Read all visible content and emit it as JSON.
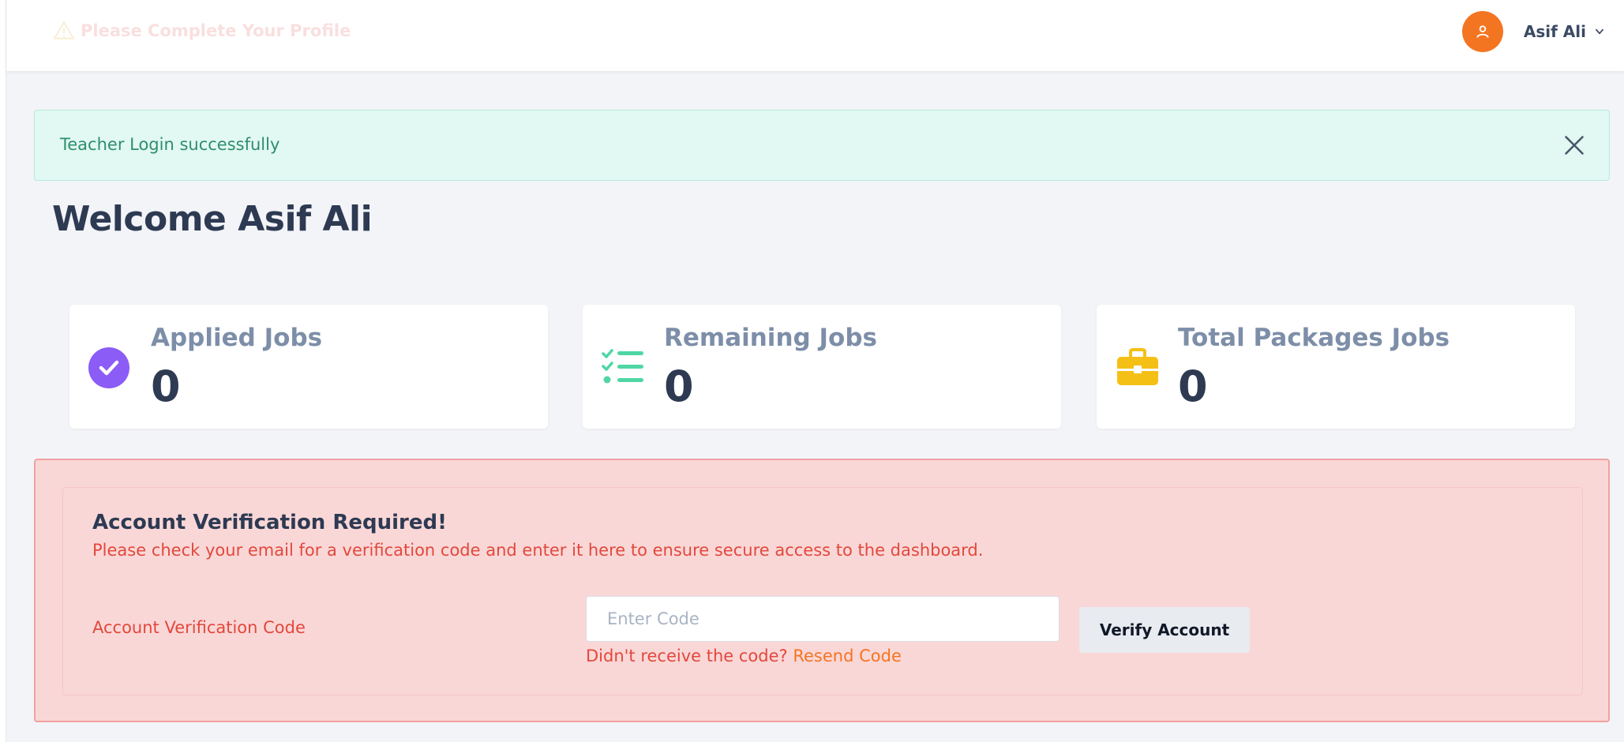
{
  "topbar": {
    "profile_warning": "Please Complete Your Profile",
    "user_name": "Asif Ali"
  },
  "alert": {
    "message": "Teacher Login successfully"
  },
  "welcome": {
    "title": "Welcome Asif Ali"
  },
  "stats": [
    {
      "title": "Applied Jobs",
      "value": "0",
      "icon": "check-circle-icon",
      "color": "#8b5cf6"
    },
    {
      "title": "Remaining Jobs",
      "value": "0",
      "icon": "checklist-icon",
      "color": "#4fd6a4"
    },
    {
      "title": "Total Packages Jobs",
      "value": "0",
      "icon": "briefcase-icon",
      "color": "#f5c016"
    }
  ],
  "verification": {
    "title": "Account Verification Required!",
    "description": "Please check your email for a verification code and enter it here to ensure secure access to the dashboard.",
    "code_label": "Account Verification Code",
    "code_placeholder": "Enter Code",
    "code_value": "",
    "not_received": "Didn't receive the code?",
    "resend_label": "Resend Code",
    "verify_button": "Verify Account"
  },
  "colors": {
    "accent_orange": "#f47521",
    "success_bg": "#e2f8f2",
    "danger_bg": "#fad7d7",
    "danger_text": "#e2483c"
  }
}
